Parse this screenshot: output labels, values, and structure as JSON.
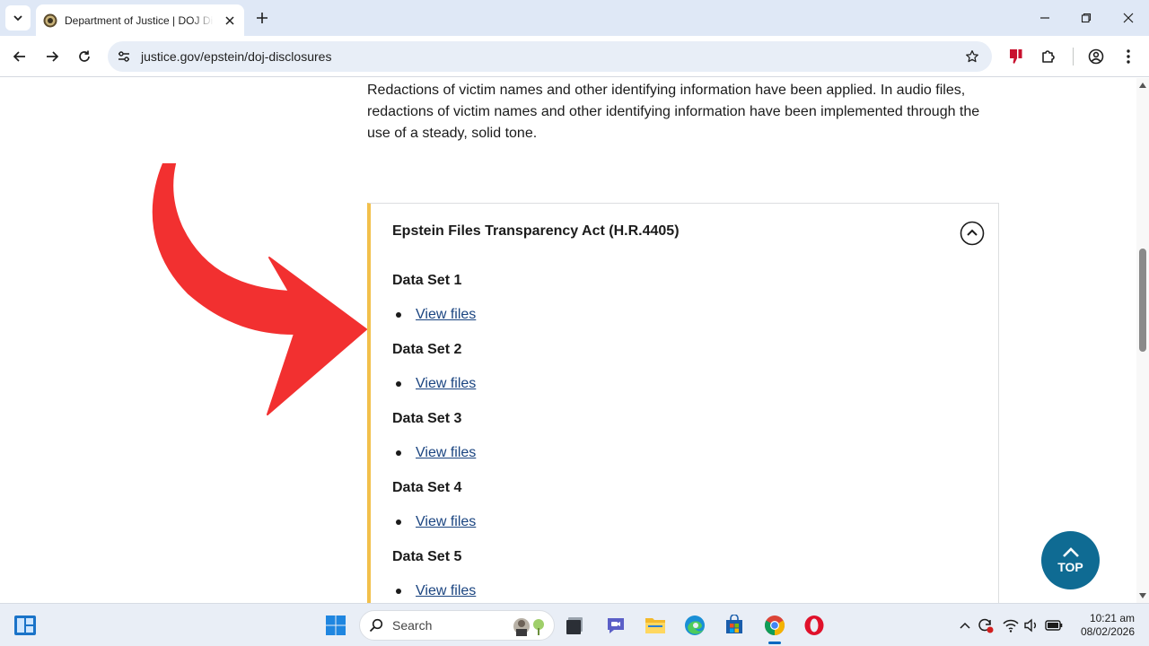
{
  "browser": {
    "tab": {
      "title": "Department of Justice | DOJ Disclosures"
    },
    "address_bar": {
      "url": "justice.gov/epstein/doj-disclosures"
    }
  },
  "page": {
    "intro_text": "Redactions of victim names and other identifying information have been applied. In audio files, redactions of victim names and other identifying information have been implemented through the use of a steady, solid tone.",
    "accordion": {
      "heading": "Epstein Files Transparency Act (H.R.4405)",
      "data_sets": [
        {
          "title": "Data Set 1",
          "link": "View files"
        },
        {
          "title": "Data Set 2",
          "link": "View files"
        },
        {
          "title": "Data Set 3",
          "link": "View files"
        },
        {
          "title": "Data Set 4",
          "link": "View files"
        },
        {
          "title": "Data Set 5",
          "link": "View files"
        }
      ]
    },
    "top_button": {
      "label": "TOP"
    }
  },
  "taskbar": {
    "search_label": "Search",
    "clock": {
      "time": "10:21 am",
      "date": "08/02/2026"
    }
  },
  "colors": {
    "accordion_accent": "#f2c04b",
    "link": "#1a4480",
    "top_button": "#0f6b93",
    "annotation_arrow": "#f23030"
  }
}
